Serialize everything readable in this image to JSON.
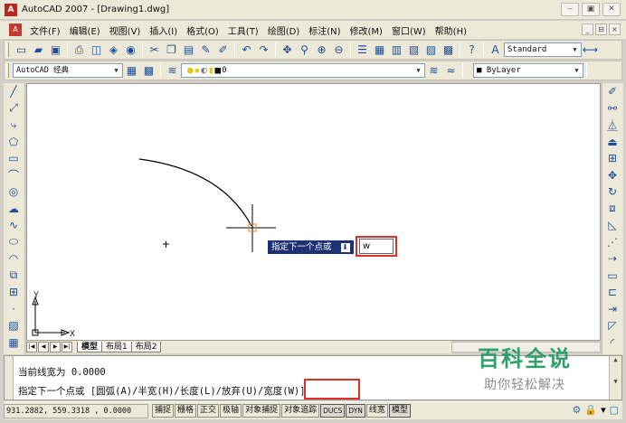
{
  "window": {
    "title": "AutoCAD 2007 - [Drawing1.dwg]",
    "app_icon": "autocad-logo-icon",
    "controls": [
      "minimize-icon",
      "maximize-icon",
      "close-icon"
    ]
  },
  "menubar": {
    "items": [
      "文件(F)",
      "编辑(E)",
      "视图(V)",
      "插入(I)",
      "格式(O)",
      "工具(T)",
      "绘图(D)",
      "标注(N)",
      "修改(M)",
      "窗口(W)",
      "帮助(H)"
    ],
    "doc_controls": [
      "_",
      "⊟",
      "×"
    ]
  },
  "toolbar_standard": {
    "text_style": "Standard"
  },
  "toolbar_layers": {
    "workspace": "AutoCAD 经典",
    "layer": "0",
    "color": "ByLayer"
  },
  "left_tools": [
    "line-icon",
    "construction-line-icon",
    "polyline-icon",
    "polygon-icon",
    "rectangle-icon",
    "arc-icon",
    "circle-icon",
    "revision-cloud-icon",
    "spline-icon",
    "ellipse-icon",
    "ellipse-arc-icon",
    "insert-block-icon",
    "make-block-icon",
    "point-icon",
    "hatch-icon",
    "gradient-icon"
  ],
  "right_tools": [
    "erase-icon",
    "copy-icon",
    "mirror-icon",
    "offset-icon",
    "array-icon",
    "move-icon",
    "rotate-icon",
    "scale-icon",
    "stretch-icon",
    "trim-icon",
    "extend-icon",
    "break-at-point-icon",
    "break-icon",
    "join-icon",
    "chamfer-icon",
    "fillet-icon"
  ],
  "canvas": {
    "ucs_x": "X",
    "ucs_y": "Y"
  },
  "dynamic_input": {
    "prompt": "指定下一个点或",
    "value": "w"
  },
  "layout_tabs": {
    "items": [
      "模型",
      "布局1",
      "布局2"
    ],
    "active": "模型"
  },
  "command": {
    "line1": "当前线宽为 0.0000",
    "line2": "指定下一个点或 [圆弧(A)/半宽(H)/长度(L)/放弃(U)/宽度(W)]"
  },
  "statusbar": {
    "coords": "931.2882,  559.3318 , 0.0000",
    "buttons": [
      "捕捉",
      "栅格",
      "正交",
      "极轴",
      "对象捕捉",
      "对象追踪",
      "DUCS",
      "DYN",
      "线宽",
      "模型"
    ]
  },
  "watermark": {
    "title": "百科全说",
    "subtitle": "助你轻松解决"
  },
  "colors": {
    "highlight": "#d8322b",
    "tooltip_bg": "#1d3275",
    "watermark_green": "#2fa06a"
  }
}
